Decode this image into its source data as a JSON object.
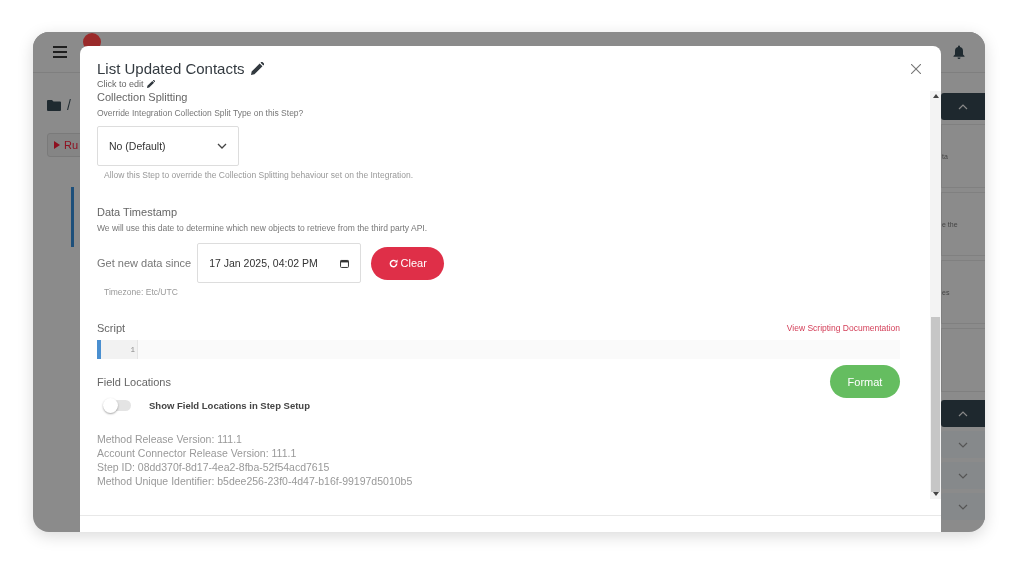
{
  "app": {
    "breadcrumb_separator": "/",
    "run_button": "Ru",
    "side_texts": [
      "ta",
      "e the",
      "es"
    ],
    "side_panels": [
      {
        "expanded": true
      },
      {
        "expanded": true
      },
      {
        "expanded": false
      },
      {
        "expanded": false
      },
      {
        "expanded": false
      }
    ]
  },
  "modal": {
    "title": "List Updated Contacts",
    "subtitle": "Click to edit",
    "collection_splitting": {
      "heading": "Collection Splitting",
      "question": "Override Integration Collection Split Type on this Step?",
      "select_value": "No (Default)",
      "help": "Allow this Step to override the Collection Splitting behaviour set on the Integration."
    },
    "data_timestamp": {
      "heading": "Data Timestamp",
      "description": "We will use this date to determine which new objects to retrieve from the third party API.",
      "field_label": "Get new data since",
      "value": "17 Jan 2025, 04:02 PM",
      "clear_button": "Clear",
      "timezone": "Timezone: Etc/UTC"
    },
    "script": {
      "label": "Script",
      "docs_link": "View Scripting Documentation",
      "line_numbers": [
        "1"
      ],
      "format_button": "Format"
    },
    "field_locations": {
      "label": "Field Locations",
      "toggle": {
        "label": "Show Field Locations in Step Setup",
        "on": false
      }
    },
    "meta": [
      "Method Release Version: 111.1",
      "Account Connector Release Version: 111.1",
      "Step ID: 08dd370f-8d17-4ea2-8fba-52f54acd7615",
      "Method Unique Identifier: b5dee256-23f0-4d47-b16f-99197d5010b5"
    ]
  }
}
